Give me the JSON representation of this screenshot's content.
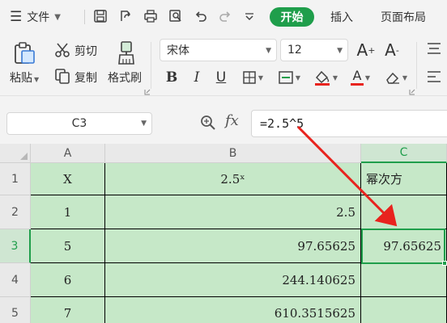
{
  "menu": {
    "file_label": "文件",
    "tabs": [
      "开始",
      "插入",
      "页面布局"
    ]
  },
  "ribbon": {
    "paste_label": "粘贴",
    "cut_label": "剪切",
    "copy_label": "复制",
    "format_painter_label": "格式刷",
    "font_name": "宋体",
    "font_size": "12"
  },
  "formula_bar": {
    "name_box": "C3",
    "fx_label": "fx",
    "formula": "=2.5^5"
  },
  "sheet": {
    "columns": [
      "A",
      "B",
      "C"
    ],
    "rows": [
      "1",
      "2",
      "3",
      "4",
      "5"
    ],
    "cells": {
      "A1": "X",
      "B1": "2.5ˣ",
      "C1": "幂次方",
      "A2": "1",
      "B2": "2.5",
      "C2": "",
      "A3": "5",
      "B3": "97.65625",
      "C3": "97.65625",
      "A4": "6",
      "B4": "244.140625",
      "C4": "",
      "A5": "7",
      "B5": "610.3515625",
      "C5": ""
    },
    "active_cell": "C3"
  },
  "colors": {
    "accent_green": "#1f9e4b",
    "cell_fill": "#c6e8c8",
    "arrow_red": "#e8231e"
  }
}
